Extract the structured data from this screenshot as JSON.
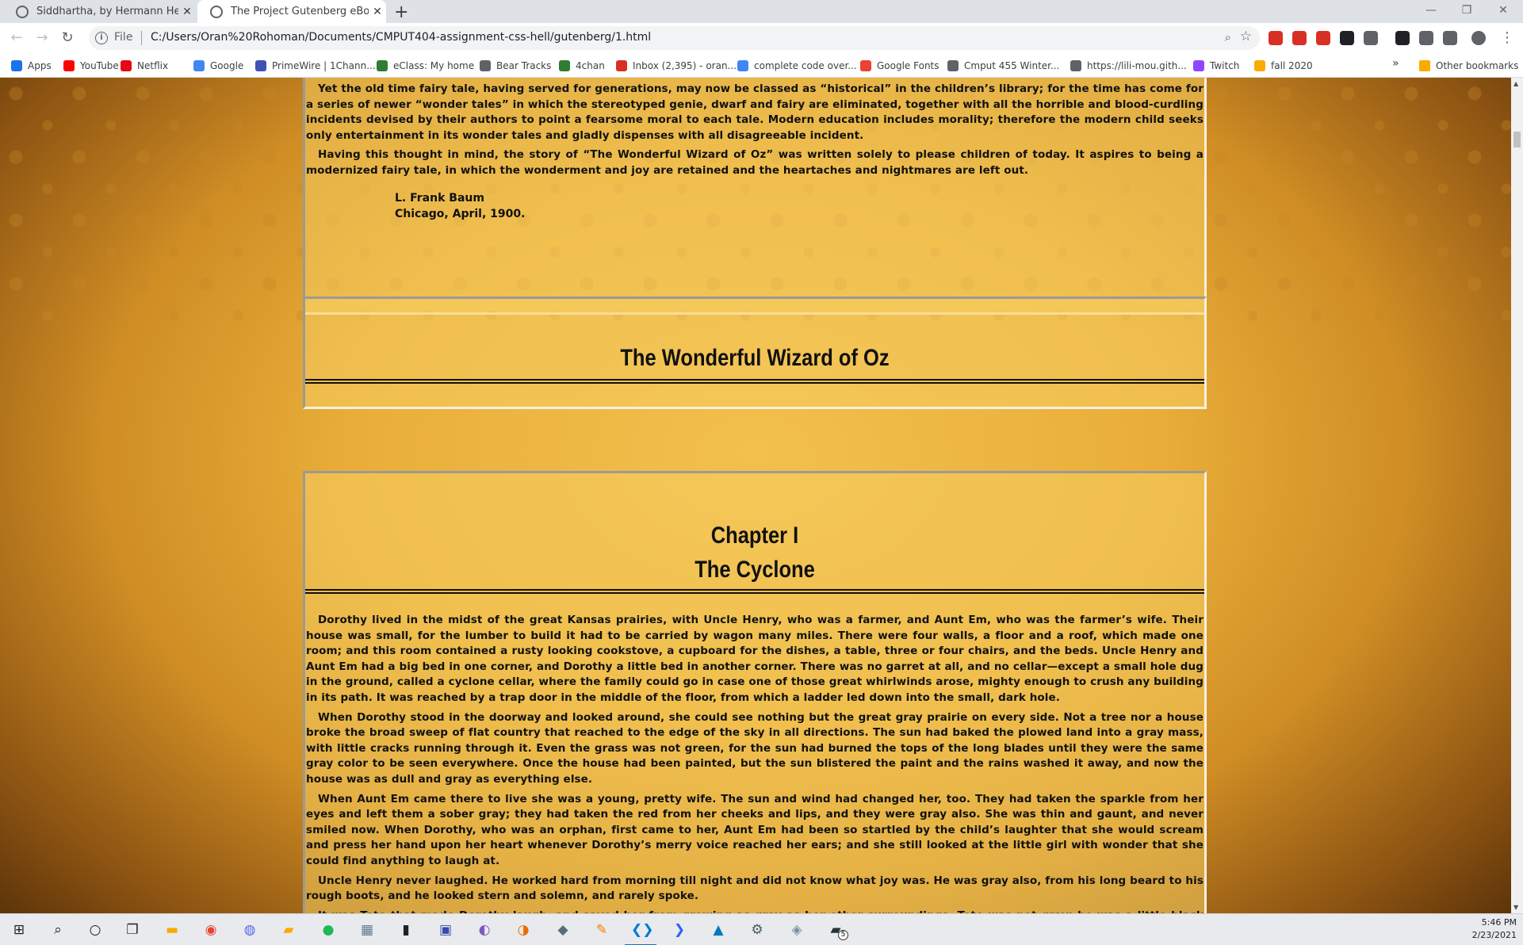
{
  "browser": {
    "tabs": [
      {
        "title": "Siddhartha, by Hermann Hesse",
        "active": false
      },
      {
        "title": "The Project Gutenberg eBook of",
        "active": true
      }
    ],
    "new_tab_glyph": "+",
    "window_controls": {
      "minimize": "—",
      "restore": "❐",
      "close": "✕"
    },
    "address": {
      "scheme": "File",
      "url": "C:/Users/Oran%20Rohoman/Documents/CMPUT404-assignment-css-hell/gutenberg/1.html"
    },
    "extensions": [
      {
        "name": "adblock-icon",
        "color": "#d93025"
      },
      {
        "name": "stop-icon",
        "color": "#d93025"
      },
      {
        "name": "video-icon",
        "color": "#d93025"
      },
      {
        "name": "sync-icon",
        "color": "#202124"
      },
      {
        "name": "half-circle-icon",
        "color": "#5f6368"
      },
      {
        "name": "shield-icon",
        "color": "#202124"
      },
      {
        "name": "puzzle-icon",
        "color": "#5f6368"
      },
      {
        "name": "queue-icon",
        "color": "#5f6368"
      }
    ]
  },
  "bookmarks": {
    "items": [
      {
        "label": "Apps",
        "icon": "apps-grid-icon",
        "color": "#1a73e8"
      },
      {
        "label": "YouTube",
        "icon": "youtube-icon",
        "color": "#ff0000"
      },
      {
        "label": "Netflix",
        "icon": "netflix-icon",
        "color": "#e50914"
      },
      {
        "label": "Google",
        "icon": "google-icon",
        "color": "#4285f4"
      },
      {
        "label": "PrimeWire | 1Chann...",
        "icon": "primewire-icon",
        "color": "#3f51b5"
      },
      {
        "label": "eClass: My home",
        "icon": "eclass-icon",
        "color": "#2e7d32"
      },
      {
        "label": "Bear Tracks",
        "icon": "globe-icon",
        "color": "#5f6368"
      },
      {
        "label": "4chan",
        "icon": "4chan-icon",
        "color": "#2e7d32"
      },
      {
        "label": "Inbox (2,395) - oran...",
        "icon": "gmail-icon",
        "color": "#d93025"
      },
      {
        "label": "complete code over...",
        "icon": "docs-icon",
        "color": "#4285f4"
      },
      {
        "label": "Google Fonts",
        "icon": "fonts-icon",
        "color": "#ea4335"
      },
      {
        "label": "Cmput 455 Winter...",
        "icon": "globe-icon",
        "color": "#5f6368"
      },
      {
        "label": "https://lili-mou.gith...",
        "icon": "globe-icon",
        "color": "#5f6368"
      },
      {
        "label": "Twitch",
        "icon": "twitch-icon",
        "color": "#9146ff"
      },
      {
        "label": "fall 2020",
        "icon": "folder-icon",
        "color": "#f9ab00"
      }
    ],
    "more_glyph": "»",
    "other_label": "Other bookmarks"
  },
  "page": {
    "intro_paragraphs": [
      "Yet the old time fairy tale, having served for generations, may now be classed as “historical” in the children’s library; for the time has come for a series of newer “wonder tales” in which the stereotyped genie, dwarf and fairy are eliminated, together with all the horrible and blood-curdling incidents devised by their authors to point a fearsome moral to each tale. Modern education includes morality; therefore the modern child seeks only entertainment in its wonder tales and gladly dispenses with all disagreeable incident.",
      "Having this thought in mind, the story of “The Wonderful Wizard of Oz” was written solely to please children of today. It aspires to being a modernized fairy tale, in which the wonderment and joy are retained and the heartaches and nightmares are left out."
    ],
    "signature": {
      "author": "L. Frank Baum",
      "place_date": "Chicago, April, 1900."
    },
    "book_title": "The Wonderful Wizard of Oz",
    "chapter": {
      "number": "Chapter I",
      "name": "The Cyclone",
      "paragraphs": [
        "Dorothy lived in the midst of the great Kansas prairies, with Uncle Henry, who was a farmer, and Aunt Em, who was the farmer’s wife. Their house was small, for the lumber to build it had to be carried by wagon many miles. There were four walls, a floor and a roof, which made one room; and this room contained a rusty looking cookstove, a cupboard for the dishes, a table, three or four chairs, and the beds. Uncle Henry and Aunt Em had a big bed in one corner, and Dorothy a little bed in another corner. There was no garret at all, and no cellar—except a small hole dug in the ground, called a cyclone cellar, where the family could go in case one of those great whirlwinds arose, mighty enough to crush any building in its path. It was reached by a trap door in the middle of the floor, from which a ladder led down into the small, dark hole.",
        "When Dorothy stood in the doorway and looked around, she could see nothing but the great gray prairie on every side. Not a tree nor a house broke the broad sweep of flat country that reached to the edge of the sky in all directions. The sun had baked the plowed land into a gray mass, with little cracks running through it. Even the grass was not green, for the sun had burned the tops of the long blades until they were the same gray color to be seen everywhere. Once the house had been painted, but the sun blistered the paint and the rains washed it away, and now the house was as dull and gray as everything else.",
        "When Aunt Em came there to live she was a young, pretty wife. The sun and wind had changed her, too. They had taken the sparkle from her eyes and left them a sober gray; they had taken the red from her cheeks and lips, and they were gray also. She was thin and gaunt, and never smiled now. When Dorothy, who was an orphan, first came to her, Aunt Em had been so startled by the child’s laughter that she would scream and press her hand upon her heart whenever Dorothy’s merry voice reached her ears; and she still looked at the little girl with wonder that she could find anything to laugh at.",
        "Uncle Henry never laughed. He worked hard from morning till night and did not know what joy was. He was gray also, from his long beard to his rough boots, and he looked stern and solemn, and rarely spoke.",
        "It was Toto that made Dorothy laugh, and saved her from growing as gray as her other surroundings. Toto was not gray; he was a little black dog, with long silky hair and small black eyes that twinkled merrily on either side of his funny, wee nose."
      ]
    }
  },
  "taskbar": {
    "apps": [
      {
        "name": "windows-start-icon",
        "glyph": "⊞",
        "color": "#202124"
      },
      {
        "name": "search-icon",
        "glyph": "⌕",
        "color": "#202124"
      },
      {
        "name": "cortana-icon",
        "glyph": "○",
        "color": "#202124"
      },
      {
        "name": "task-view-icon",
        "glyph": "❐",
        "color": "#202124"
      },
      {
        "name": "file-explorer-icon",
        "glyph": "▬",
        "color": "#f9ab00"
      },
      {
        "name": "chrome-icon",
        "glyph": "◉",
        "color": "#ea4335"
      },
      {
        "name": "discord-icon",
        "glyph": "◍",
        "color": "#5865f2"
      },
      {
        "name": "notes-icon",
        "glyph": "▰",
        "color": "#f9ab00"
      },
      {
        "name": "spotify-icon",
        "glyph": "●",
        "color": "#1db954"
      },
      {
        "name": "photos-icon",
        "glyph": "▦",
        "color": "#607d8b"
      },
      {
        "name": "terminal-icon",
        "glyph": "▮",
        "color": "#202124"
      },
      {
        "name": "network-icon",
        "glyph": "▣",
        "color": "#3949ab"
      },
      {
        "name": "app-purple-icon",
        "glyph": "◐",
        "color": "#7e57c2"
      },
      {
        "name": "app-orange-icon",
        "glyph": "◑",
        "color": "#ef6c00"
      },
      {
        "name": "box-icon",
        "glyph": "◆",
        "color": "#546e7a"
      },
      {
        "name": "paint-icon",
        "glyph": "✎",
        "color": "#f57c00"
      },
      {
        "name": "vscode-icon",
        "glyph": "❮❯",
        "color": "#0078d4"
      },
      {
        "name": "powershell-icon",
        "glyph": "❯",
        "color": "#2962ff"
      },
      {
        "name": "app-blue-icon",
        "glyph": "▲",
        "color": "#0277bd"
      },
      {
        "name": "settings-icon",
        "glyph": "⚙",
        "color": "#455a64"
      },
      {
        "name": "app-grey-icon",
        "glyph": "◈",
        "color": "#78909c"
      },
      {
        "name": "app-dark-icon",
        "glyph": "▰",
        "color": "#263238"
      }
    ],
    "badge": "5",
    "time": "5:46 PM",
    "date": "2/23/2021"
  }
}
